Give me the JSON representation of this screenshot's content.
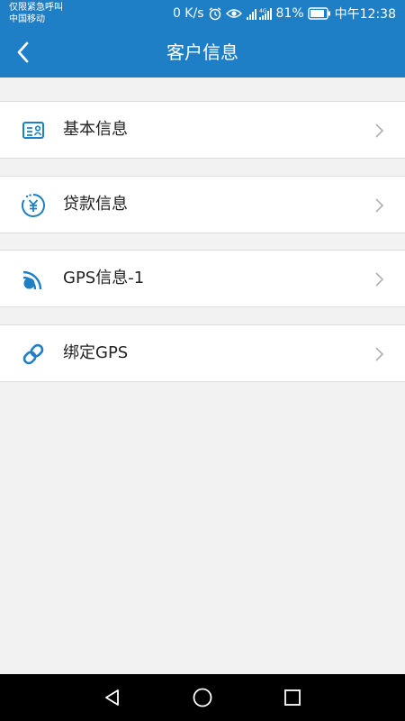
{
  "status_bar": {
    "emergency_text": "仅限紧急呼叫",
    "carrier": "中国移动",
    "net_speed": "0 K/s",
    "network_type": "4G",
    "battery_percent": "81%",
    "time": "中午12:38",
    "icons": [
      "alarm-icon",
      "eye-comfort-icon",
      "signal-icon",
      "battery-icon"
    ]
  },
  "header": {
    "title": "客户信息",
    "back_icon": "back-arrow-icon"
  },
  "menu": {
    "items": [
      {
        "label": "基本信息",
        "icon": "id-card-icon"
      },
      {
        "label": "贷款信息",
        "icon": "yuan-coin-icon"
      },
      {
        "label": "GPS信息-1",
        "icon": "gps-signal-icon"
      },
      {
        "label": "绑定GPS",
        "icon": "link-icon"
      }
    ],
    "chevron_icon": "chevron-right-icon"
  },
  "nav_bar": {
    "buttons": [
      "back-triangle-icon",
      "home-circle-icon",
      "recents-square-icon"
    ]
  },
  "colors": {
    "primary": "#1e7fc6",
    "background": "#f2f2f2",
    "item_background": "#ffffff",
    "icon_accent": "#1e7fc6",
    "chevron": "#b0b0b0"
  }
}
